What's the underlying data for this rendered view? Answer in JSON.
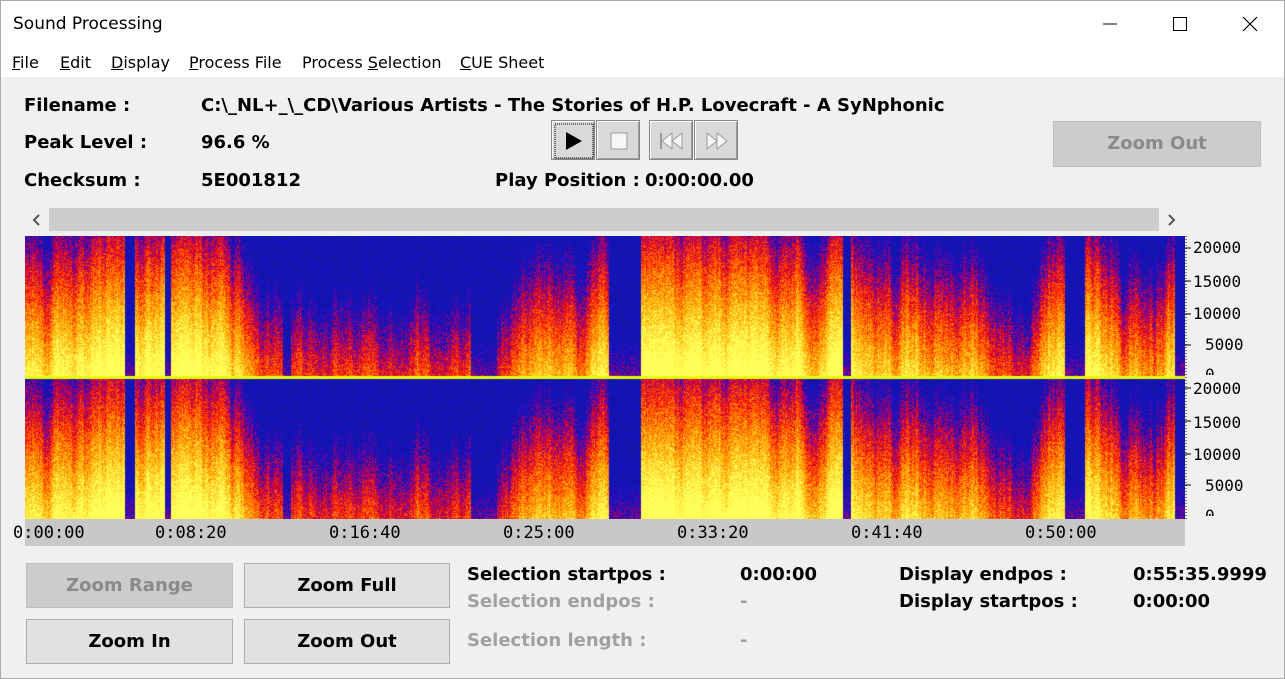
{
  "window": {
    "title": "Sound Processing"
  },
  "menu": [
    {
      "label_underlined": "F",
      "label_rest": "ile"
    },
    {
      "label_underlined": "E",
      "label_rest": "dit"
    },
    {
      "label_underlined": "D",
      "label_rest": "isplay"
    },
    {
      "label_underlined": "P",
      "label_rest": "rocess File"
    },
    {
      "label_pre": "Process ",
      "label_underlined": "S",
      "label_rest": "election"
    },
    {
      "label_underlined": "C",
      "label_rest": "UE Sheet"
    }
  ],
  "info": {
    "filename_label": "Filename :",
    "filename_value": "C:\\_NL+_\\_CD\\Various Artists - The Stories of H.P. Lovecraft - A SyNphonic",
    "peak_label": "Peak Level :",
    "peak_value": "96.6 %",
    "checksum_label": "Checksum :",
    "checksum_value": "5E001812",
    "play_position_label": "Play Position :",
    "play_position_value": "0:00:00.00"
  },
  "transport": {
    "play_icon": "play-icon",
    "stop_icon": "stop-icon",
    "rewind_icon": "rewind-icon",
    "forward_icon": "fast-forward-icon"
  },
  "top_zoom_out": {
    "label": "Zoom Out",
    "enabled": false
  },
  "spectrogram": {
    "time_ticks": [
      "0:00:00",
      "0:08:20",
      "0:16:40",
      "0:25:00",
      "0:33:20",
      "0:41:40",
      "0:50:00"
    ],
    "freq_ticks": [
      "20000",
      "15000",
      "10000",
      "5000",
      "0"
    ],
    "colors": {
      "low": "#1010c8",
      "mid": "#ff2a00",
      "high": "#ffff40",
      "divider": "#e6ff00"
    }
  },
  "buttons": {
    "zoom_range": {
      "label": "Zoom Range",
      "enabled": false
    },
    "zoom_full": {
      "label": "Zoom Full",
      "enabled": true
    },
    "zoom_in": {
      "label": "Zoom In",
      "enabled": true
    },
    "zoom_out": {
      "label": "Zoom Out",
      "enabled": true
    }
  },
  "selection": {
    "startpos_label": "Selection startpos :",
    "startpos_value": "0:00:00",
    "endpos_label": "Selection endpos :",
    "endpos_value": "-",
    "length_label": "Selection length :",
    "length_value": "-"
  },
  "display": {
    "endpos_label": "Display endpos :",
    "endpos_value": "0:55:35.9999",
    "startpos_label": "Display startpos :",
    "startpos_value": "0:00:00"
  }
}
